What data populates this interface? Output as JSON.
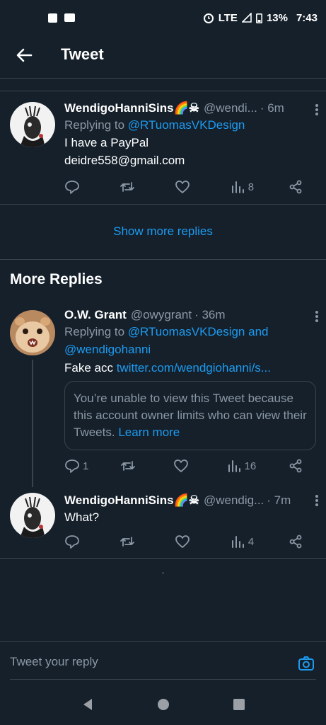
{
  "status_bar": {
    "network": "LTE",
    "battery": "13%",
    "time": "7:43"
  },
  "header": {
    "title": "Tweet"
  },
  "tweet1": {
    "name": "WendigoHanniSins🌈☠",
    "handle": "@wendi...",
    "time": "· 6m",
    "replying_prefix": "Replying to ",
    "replying_to": "@RTuomasVKDesign",
    "text_line1": "I have a PayPal",
    "text_line2": "deidre558@gmail.com",
    "views": "8"
  },
  "show_more_replies": "Show more replies",
  "more_replies_title": "More Replies",
  "tweet2": {
    "name": "O.W. Grant",
    "handle": "@owygrant",
    "time": "· 36m",
    "replying_prefix": "Replying to ",
    "replying_to_1": "@RTuomasVKDesign",
    "replying_and": " and",
    "replying_to_2": "@wendigohanni",
    "text_prefix": "Fake acc ",
    "text_link": "twitter.com/wendgiohanni/s...",
    "quote_text": "You’re unable to view this Tweet because this account owner limits who can view their Tweets.",
    "quote_link": "Learn more",
    "replies": "1",
    "views": "16"
  },
  "tweet3": {
    "name": "WendigoHanniSins🌈☠",
    "handle": "@wendig...",
    "time": "· 7m",
    "text": "What?",
    "views": "4"
  },
  "composer": {
    "placeholder": "Tweet your reply"
  },
  "colors": {
    "background": "#15202b",
    "accent": "#1d9bf0",
    "muted": "#8b98a5",
    "divider": "#38444d"
  }
}
